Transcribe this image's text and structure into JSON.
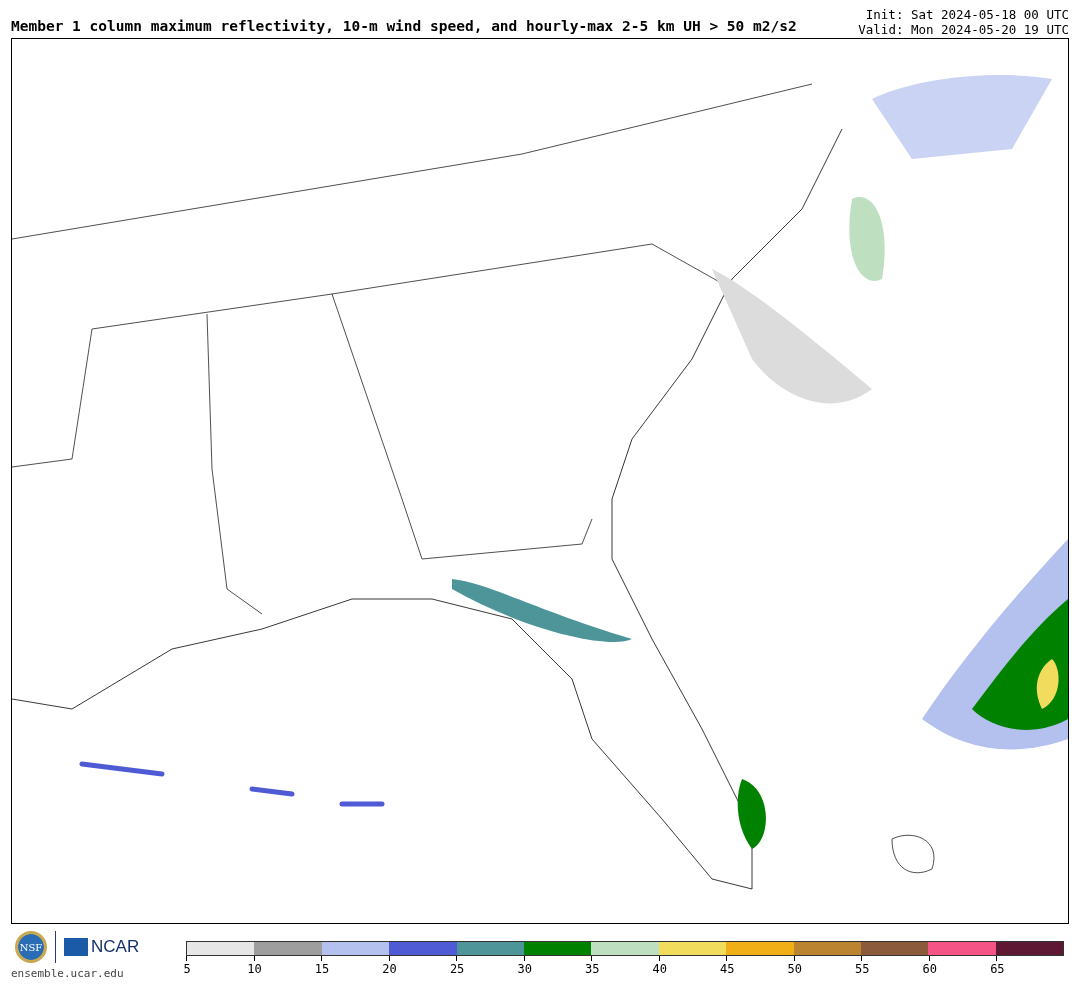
{
  "header": {
    "title": "Member 1 column maximum reflectivity, 10-m wind speed, and hourly-max 2-5 km UH > 50 m2/s2",
    "init": "Init: Sat 2024-05-18 00 UTC",
    "valid": "Valid: Mon 2024-05-20 19 UTC"
  },
  "footer": {
    "nsf_logo": "NSF",
    "ncar_logo": "NCAR",
    "site": "ensemble.ucar.edu"
  },
  "colorbar": {
    "bins": [
      {
        "color": "#e6e6e6",
        "label": "5"
      },
      {
        "color": "#9e9e9e",
        "label": "10"
      },
      {
        "color": "#b4c0ee",
        "label": "15"
      },
      {
        "color": "#4f5bd5",
        "label": "20"
      },
      {
        "color": "#4d9598",
        "label": "25"
      },
      {
        "color": "#008200",
        "label": "30"
      },
      {
        "color": "#bfe0c0",
        "label": "35"
      },
      {
        "color": "#f2dc5d",
        "label": "40"
      },
      {
        "color": "#f0ae17",
        "label": "45"
      },
      {
        "color": "#bb8431",
        "label": "50"
      },
      {
        "color": "#8b5a3c",
        "label": "55"
      },
      {
        "color": "#f45586",
        "label": "60"
      },
      {
        "color": "#5f1834",
        "label": "65"
      }
    ]
  }
}
